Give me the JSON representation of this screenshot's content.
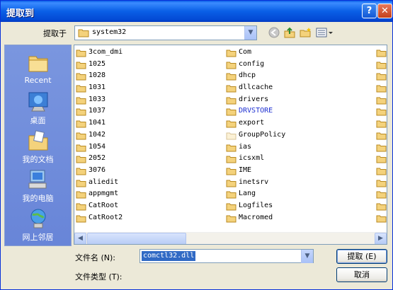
{
  "window": {
    "title": "提取到"
  },
  "lookin": {
    "label": "提取于",
    "value": "system32"
  },
  "places": [
    {
      "label": "Recent",
      "icon": "recent-folder-icon"
    },
    {
      "label": "桌面",
      "icon": "desktop-icon"
    },
    {
      "label": "我的文档",
      "icon": "my-documents-icon"
    },
    {
      "label": "我的电脑",
      "icon": "my-computer-icon"
    },
    {
      "label": "网上邻居",
      "icon": "network-places-icon"
    }
  ],
  "files": {
    "col1": [
      "3com_dmi",
      "1025",
      "1028",
      "1031",
      "1033",
      "1037",
      "1041",
      "1042",
      "1054",
      "2052",
      "3076",
      "aliedit",
      "appmgmt",
      "CatRoot",
      "CatRoot2"
    ],
    "col2": [
      "Com",
      "config",
      "dhcp",
      "dllcache",
      "drivers",
      "DRVSTORE",
      "export",
      "GroupPolicy",
      "ias",
      "icsxml",
      "IME",
      "inetsrv",
      "Lang",
      "Logfiles",
      "Macromed"
    ]
  },
  "filename": {
    "label": "文件名 (N):",
    "value": "comctl32.dll"
  },
  "filetype": {
    "label": "文件类型 (T):"
  },
  "buttons": {
    "ok": "提取 (E)",
    "cancel": "取消"
  },
  "colors": {
    "title_bar": "#0a5fe6",
    "places_bar": "#6f8bd9",
    "selection": "#316ac5",
    "folder": "#f4d27c"
  }
}
